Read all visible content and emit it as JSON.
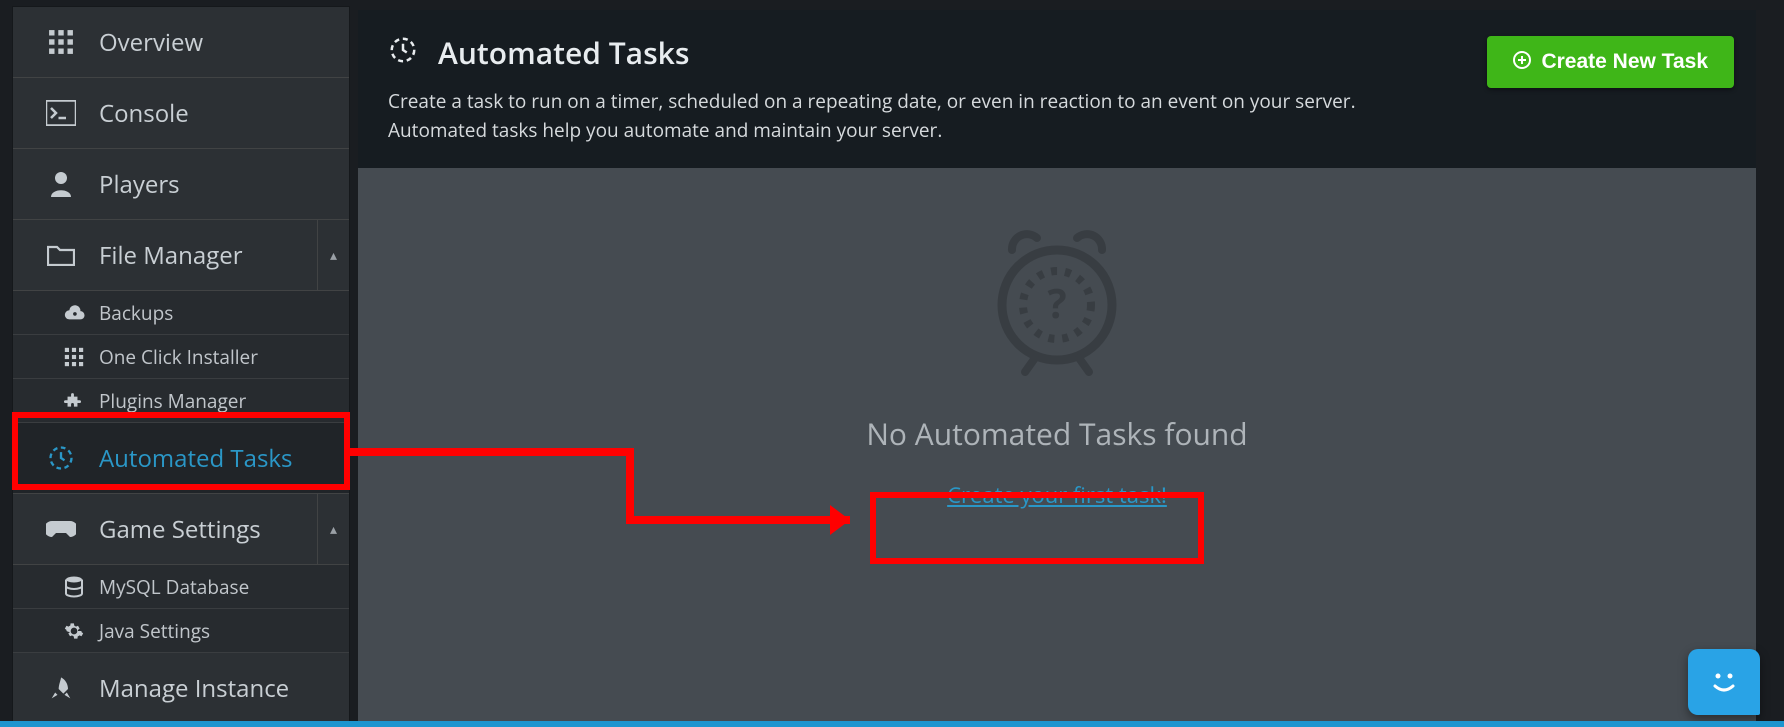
{
  "sidebar": {
    "items": {
      "overview": "Overview",
      "console": "Console",
      "players": "Players",
      "file_manager": "File Manager",
      "automated_tasks": "Automated Tasks",
      "game_settings": "Game Settings",
      "manage_instance": "Manage Instance"
    },
    "file_manager_sub": {
      "backups": "Backups",
      "one_click": "One Click Installer",
      "plugins": "Plugins Manager"
    },
    "game_settings_sub": {
      "mysql": "MySQL Database",
      "java": "Java Settings"
    }
  },
  "header": {
    "title": "Automated Tasks",
    "description": "Create a task to run on a timer, scheduled on a repeating date, or even in reaction to an event on your server. Automated tasks help you automate and maintain your server.",
    "create_button": "Create New Task"
  },
  "empty_state": {
    "title": "No Automated Tasks found",
    "link": "Create your first task!"
  },
  "colors": {
    "accent": "#2a97c7",
    "success": "#3fb618",
    "annotation": "#ff0000"
  }
}
